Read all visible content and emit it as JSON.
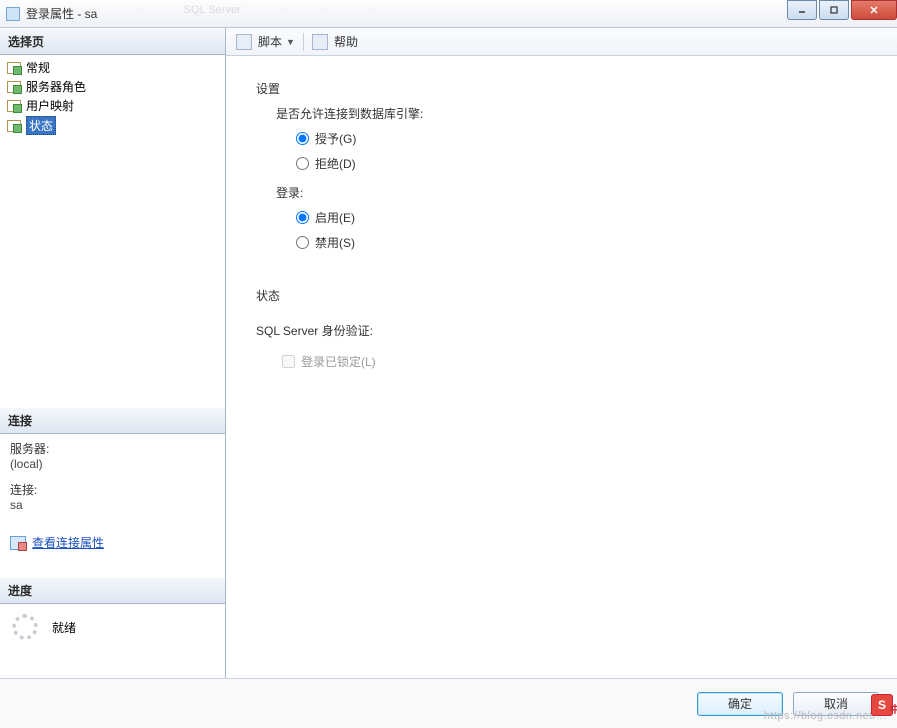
{
  "titlebar": {
    "title": "登录属性 - sa"
  },
  "sidebar": {
    "select_page_header": "选择页",
    "items": [
      {
        "label": "常规"
      },
      {
        "label": "服务器角色"
      },
      {
        "label": "用户映射"
      },
      {
        "label": "状态",
        "selected": true
      }
    ],
    "connection_header": "连接",
    "server_label": "服务器:",
    "server_value": "(local)",
    "conn_label": "连接:",
    "conn_value": "sa",
    "view_conn_props": "查看连接属性",
    "progress_header": "进度",
    "progress_status": "就绪"
  },
  "toolbar": {
    "script_label": "脚本",
    "help_label": "帮助"
  },
  "form": {
    "settings_label": "设置",
    "connect_engine_label": "是否允许连接到数据库引擎:",
    "grant_label": "授予(G)",
    "deny_label": "拒绝(D)",
    "login_label": "登录:",
    "enable_label": "启用(E)",
    "disable_label": "禁用(S)",
    "status_label": "状态",
    "sql_auth_label": "SQL Server 身份验证:",
    "locked_label": "登录已锁定(L)"
  },
  "footer": {
    "ok": "确定",
    "cancel": "取消"
  },
  "watermark": "https://blog.csdn.net/...",
  "ime": {
    "badge": "S",
    "lang": "中"
  }
}
